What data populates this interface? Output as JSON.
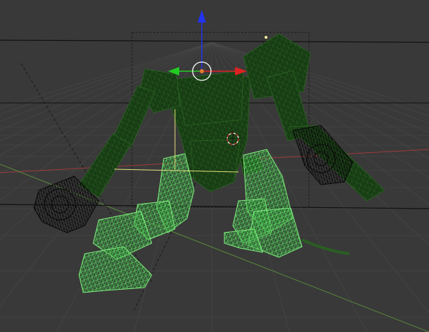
{
  "app": {
    "name": "3D Viewport",
    "mode": "wireframe"
  },
  "colors": {
    "viewport_background": "#393939",
    "grid_line": "#4a4a4a",
    "grid_line_dark": "#303030",
    "axis_x": "#a03a3a",
    "axis_y": "#5a8a3a",
    "black_line": "#111111",
    "selection_box": "#1c1c1c",
    "dark_wire": "#1e4a1a",
    "dark_wire_light": "#2a5e22",
    "bright_wire": "#4fd05a",
    "bright_wire_light": "#80ef7e",
    "black_wire": "#0a0a0a",
    "bone_line": "#e8e07a",
    "gizmo_z": "#2233ee",
    "gizmo_x": "#dd2222",
    "gizmo_y": "#22cc22",
    "gizmo_center": "#e07a30",
    "gizmo_ring": "#ffffff",
    "cursor_red": "#e03030",
    "cursor_white": "#ffffff"
  },
  "icons": {
    "transform_gizmo": "move-gizmo-icon",
    "cursor_3d": "3d-cursor-icon"
  }
}
